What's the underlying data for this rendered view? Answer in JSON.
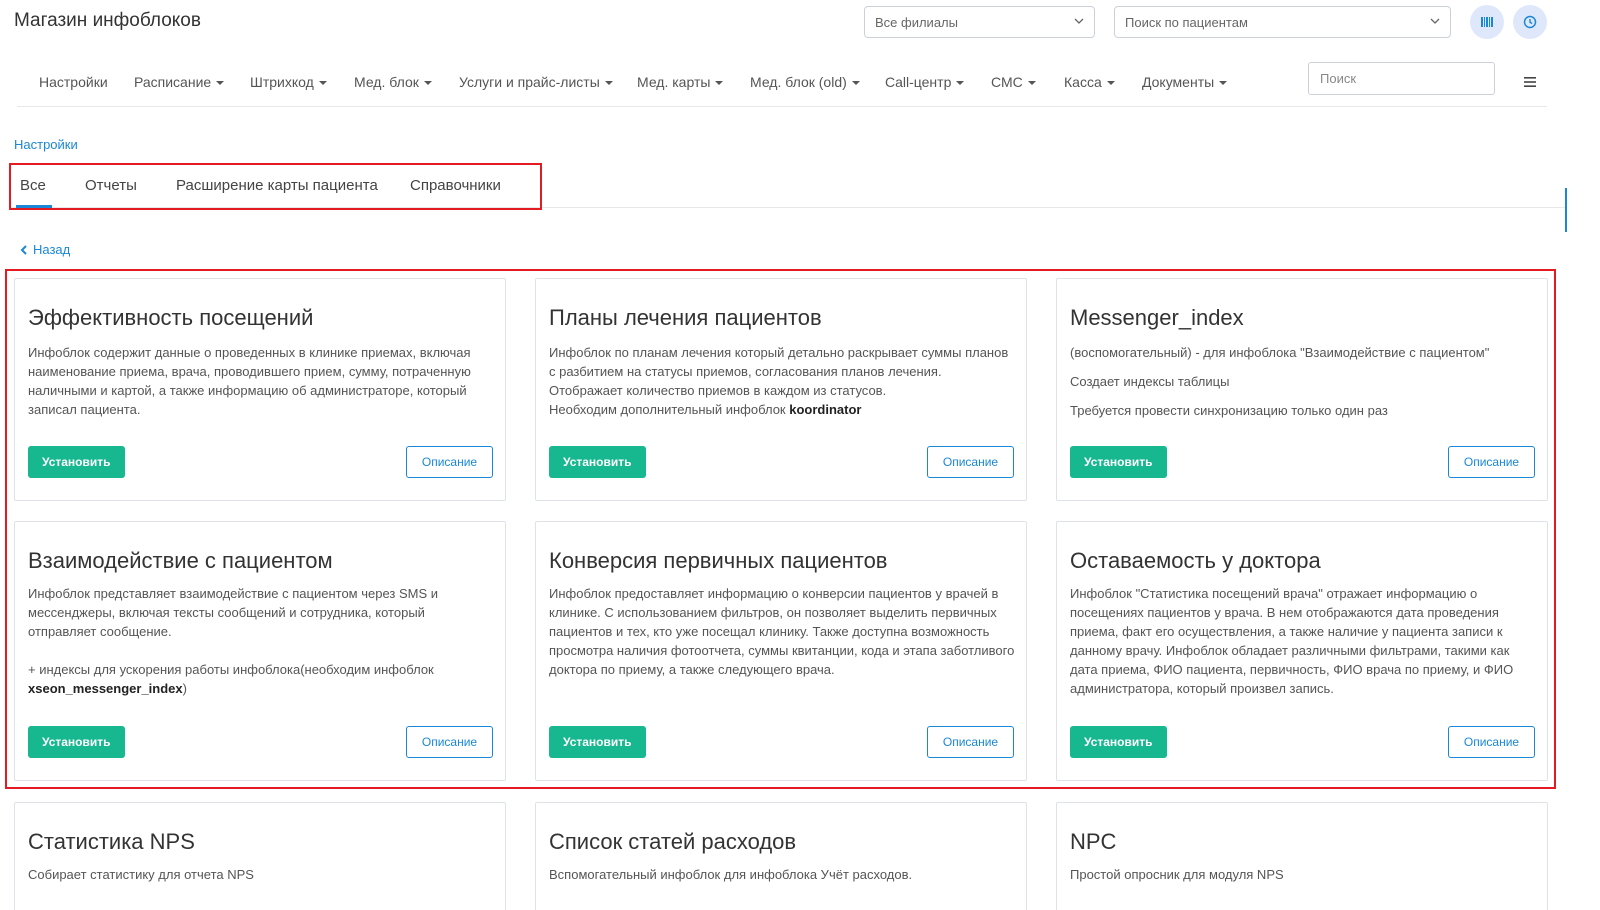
{
  "app": {
    "title": "Магазин инфоблоков"
  },
  "header": {
    "branch_select": {
      "value": "Все филиалы"
    },
    "patient_search": {
      "placeholder": "Поиск по пациентам"
    },
    "barcode_button": {
      "icon": "barcode-icon"
    },
    "clock_button": {
      "icon": "clock-icon"
    }
  },
  "nav": {
    "items": [
      {
        "label": "Настройки",
        "dropdown": false
      },
      {
        "label": "Расписание",
        "dropdown": true
      },
      {
        "label": "Штрихкод",
        "dropdown": true
      },
      {
        "label": "Мед. блок",
        "dropdown": true
      },
      {
        "label": "Услуги и прайс-листы",
        "dropdown": true
      },
      {
        "label": "Мед. карты",
        "dropdown": true
      },
      {
        "label": "Мед. блок (old)",
        "dropdown": true
      },
      {
        "label": "Call-центр",
        "dropdown": true
      },
      {
        "label": "СМС",
        "dropdown": true
      },
      {
        "label": "Касса",
        "dropdown": true
      },
      {
        "label": "Документы",
        "dropdown": true
      }
    ],
    "search_placeholder": "Поиск",
    "menu_icon": "hamburger-icon"
  },
  "breadcrumb": "Настройки",
  "tabs": [
    {
      "label": "Все",
      "active": true
    },
    {
      "label": "Отчеты",
      "active": false
    },
    {
      "label": "Расширение карты пациента",
      "active": false
    },
    {
      "label": "Справочники",
      "active": false
    }
  ],
  "back_link": {
    "label": "Назад",
    "icon": "chevron-left-icon"
  },
  "buttons": {
    "install": "Установить",
    "description": "Описание"
  },
  "cards": [
    {
      "title": "Эффективность посещений",
      "paragraphs": [
        "Инфоблок содержит данные о проведенных в клинике приемах, включая наименование приема, врача, проводившего прием, сумму, потраченную наличными и картой, а также информацию об администраторе, который записал пациента."
      ]
    },
    {
      "title": "Планы лечения пациентов",
      "paragraphs": [
        "Инфоблок по планам лечения который детально раскрывает суммы планов с разбитием на статусы приемов, согласования планов лечения. Отображает количество приемов в каждом из статусов."
      ],
      "note_prefix": "Необходим дополнительный инфоблок ",
      "note_bold": "koordinator"
    },
    {
      "title": "Messenger_index",
      "paragraphs": [
        "(воспомогательный) - для инфоблока \"Взаимодействие с пациентом\"",
        "Создает индексы таблицы",
        "Требуется провести синхронизацию только один раз"
      ]
    },
    {
      "title": "Взаимодействие с пациентом",
      "paragraphs": [
        "Инфоблок представляет взаимодействие с пациентом через SMS и мессенджеры, включая тексты сообщений и сотрудника, который отправляет сообщение."
      ],
      "note_prefix": "+ индексы для ускорения работы инфоблока(необходим инфоблок ",
      "note_bold": "xseon_messenger_index",
      "note_suffix": ")"
    },
    {
      "title": "Конверсия первичных пациентов",
      "paragraphs": [
        "Инфоблок предоставляет информацию о конверсии пациентов у врачей в клинике. С использованием фильтров, он позволяет выделить первичных пациентов и тех, кто уже посещал клинику. Также доступна возможность просмотра наличия фотоотчета, суммы квитанции, кода и этапа заботливого доктора по приему, а также следующего врача."
      ]
    },
    {
      "title": "Оставаемость у доктора",
      "paragraphs": [
        "Инфоблок \"Статистика посещений врача\" отражает информацию о посещениях пациентов у врача. В нем отображаются дата проведения приема, факт его осуществления, а также наличие у пациента записи к данному врачу. Инфоблок обладает различными фильтрами, такими как дата приема, ФИО пациента, первичность, ФИО врача по приему, и ФИО администратора, который произвел запись."
      ]
    },
    {
      "title": "Статистика NPS",
      "paragraphs": [
        "Собирает статистику для отчета NPS"
      ]
    },
    {
      "title": "Список статей расходов",
      "paragraphs": [
        "Вспомогательный инфоблок для инфоблока Учёт расходов."
      ]
    },
    {
      "title": "NPC",
      "paragraphs": [
        "Простой опросник для модуля NPS"
      ]
    }
  ],
  "colors": {
    "accent": "#1a88d6",
    "install_button": "#17b890",
    "highlight_outline": "#e31c23"
  }
}
